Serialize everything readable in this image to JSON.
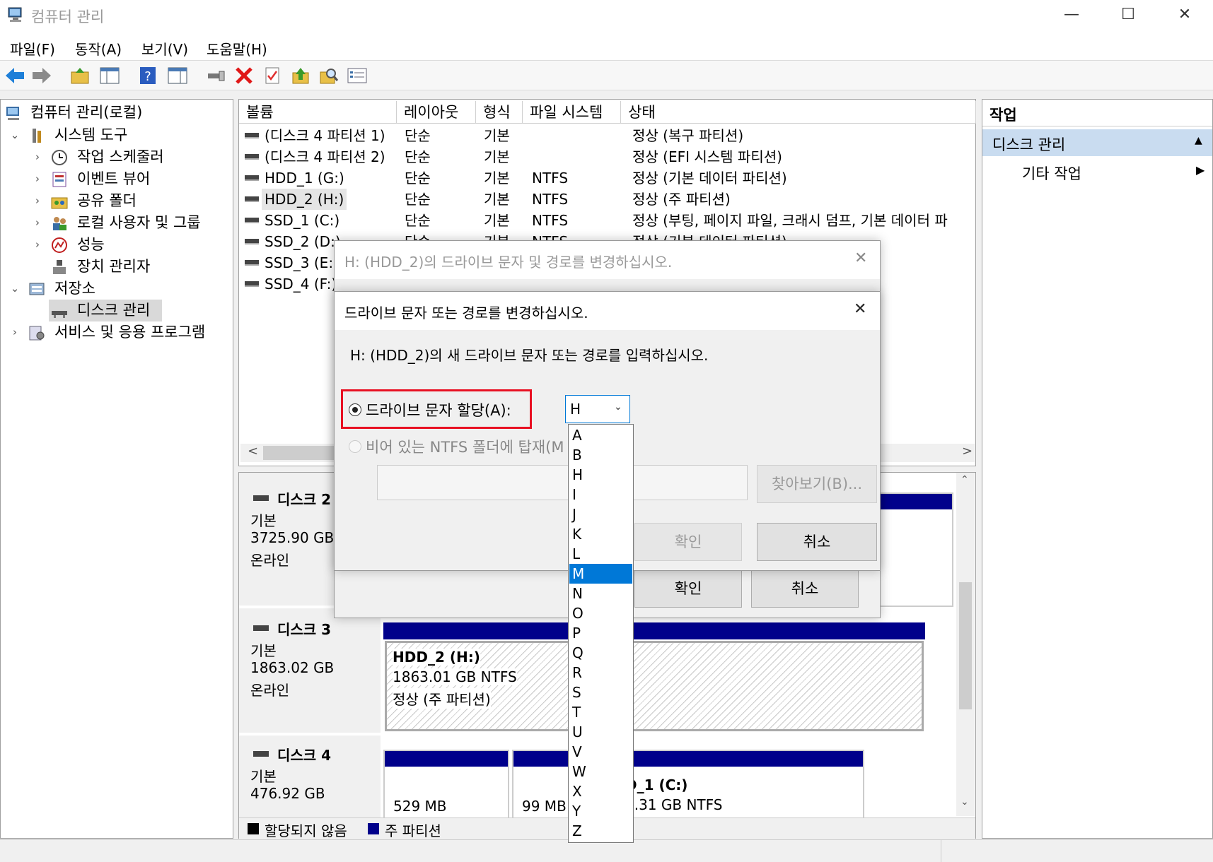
{
  "window": {
    "title": "컴퓨터 관리",
    "minimize": "—",
    "maximize": "☐",
    "close": "✕"
  },
  "menu": [
    "파일(F)",
    "동작(A)",
    "보기(V)",
    "도움말(H)"
  ],
  "toolbar_icons": [
    "back-arrow-icon",
    "forward-arrow-icon",
    "up-folder-icon",
    "show-hide-tree-icon",
    "help-icon",
    "show-action-pane-icon",
    "connect-icon",
    "delete-icon",
    "properties-icon",
    "up-level-icon",
    "search-icon",
    "list-view-icon"
  ],
  "tree": {
    "root": "컴퓨터 관리(로컬)",
    "system_tools": "시스템 도구",
    "task_scheduler": "작업 스케줄러",
    "event_viewer": "이벤트 뷰어",
    "shared_folders": "공유 폴더",
    "local_users": "로컬 사용자 및 그룹",
    "performance": "성능",
    "device_manager": "장치 관리자",
    "storage": "저장소",
    "disk_management": "디스크 관리",
    "services": "서비스 및 응용 프로그램"
  },
  "volume_table": {
    "headers": [
      "볼륨",
      "레이아웃",
      "형식",
      "파일 시스템",
      "상태"
    ],
    "rows": [
      [
        "(디스크 4 파티션 1)",
        "단순",
        "기본",
        "",
        "정상 (복구 파티션)"
      ],
      [
        "(디스크 4 파티션 2)",
        "단순",
        "기본",
        "",
        "정상 (EFI 시스템 파티션)"
      ],
      [
        "HDD_1 (G:)",
        "단순",
        "기본",
        "NTFS",
        "정상 (기본 데이터 파티션)"
      ],
      [
        "HDD_2 (H:)",
        "단순",
        "기본",
        "NTFS",
        "정상 (주 파티션)"
      ],
      [
        "SSD_1 (C:)",
        "단순",
        "기본",
        "NTFS",
        "정상 (부팅, 페이지 파일, 크래시 덤프, 기본 데이터 파"
      ],
      [
        "SSD_2 (D:)",
        "단순",
        "기본",
        "NTFS",
        "정상 (기본 데이터 파티션)"
      ],
      [
        "SSD_3 (E:)",
        "",
        "",
        "",
        ""
      ],
      [
        "SSD_4 (F:)",
        "",
        "",
        "",
        ""
      ]
    ],
    "scroll_left": "<",
    "scroll_right": ">"
  },
  "disks": [
    {
      "name": "디스크 2",
      "type": "기본",
      "size": "3725.90 GB",
      "status": "온라인"
    },
    {
      "name": "디스크 3",
      "type": "기본",
      "size": "1863.02 GB",
      "status": "온라인",
      "partition": {
        "name": "HDD_2  (H:)",
        "size": "1863.01 GB NTFS",
        "status": "정상 (주 파티션)"
      }
    },
    {
      "name": "디스크 4",
      "type": "기본",
      "size": "476.92 GB",
      "partitions": [
        "529 MB",
        "99 MB",
        "D_1  (C:)",
        "6.31 GB NTFS"
      ]
    }
  ],
  "legend": {
    "unallocated": "할당되지 않음",
    "primary": "주 파티션"
  },
  "actions": {
    "header": "작업",
    "section": "디스크 관리",
    "item": "기타 작업"
  },
  "outer_dialog": {
    "title": "H: (HDD_2)의 드라이브 문자 및 경로를 변경하십시오.",
    "ok": "확인",
    "cancel": "취소"
  },
  "inner_dialog": {
    "title": "드라이브 문자 또는 경로를 변경하십시오.",
    "prompt": "H: (HDD_2)의 새 드라이브 문자 또는 경로를 입력하십시오.",
    "assign_letter": "드라이브 문자 할당(A):",
    "mount_folder": "비어 있는 NTFS 폴더에 탑재(M",
    "browse": "찾아보기(B)...",
    "ok": "확인",
    "cancel": "취소",
    "selected_letter": "H",
    "letters": [
      "A",
      "B",
      "H",
      "I",
      "J",
      "K",
      "L",
      "M",
      "N",
      "O",
      "P",
      "Q",
      "R",
      "S",
      "T",
      "U",
      "V",
      "W",
      "X",
      "Y",
      "Z"
    ],
    "highlighted": "M",
    "highlight_color": "#e81123"
  }
}
